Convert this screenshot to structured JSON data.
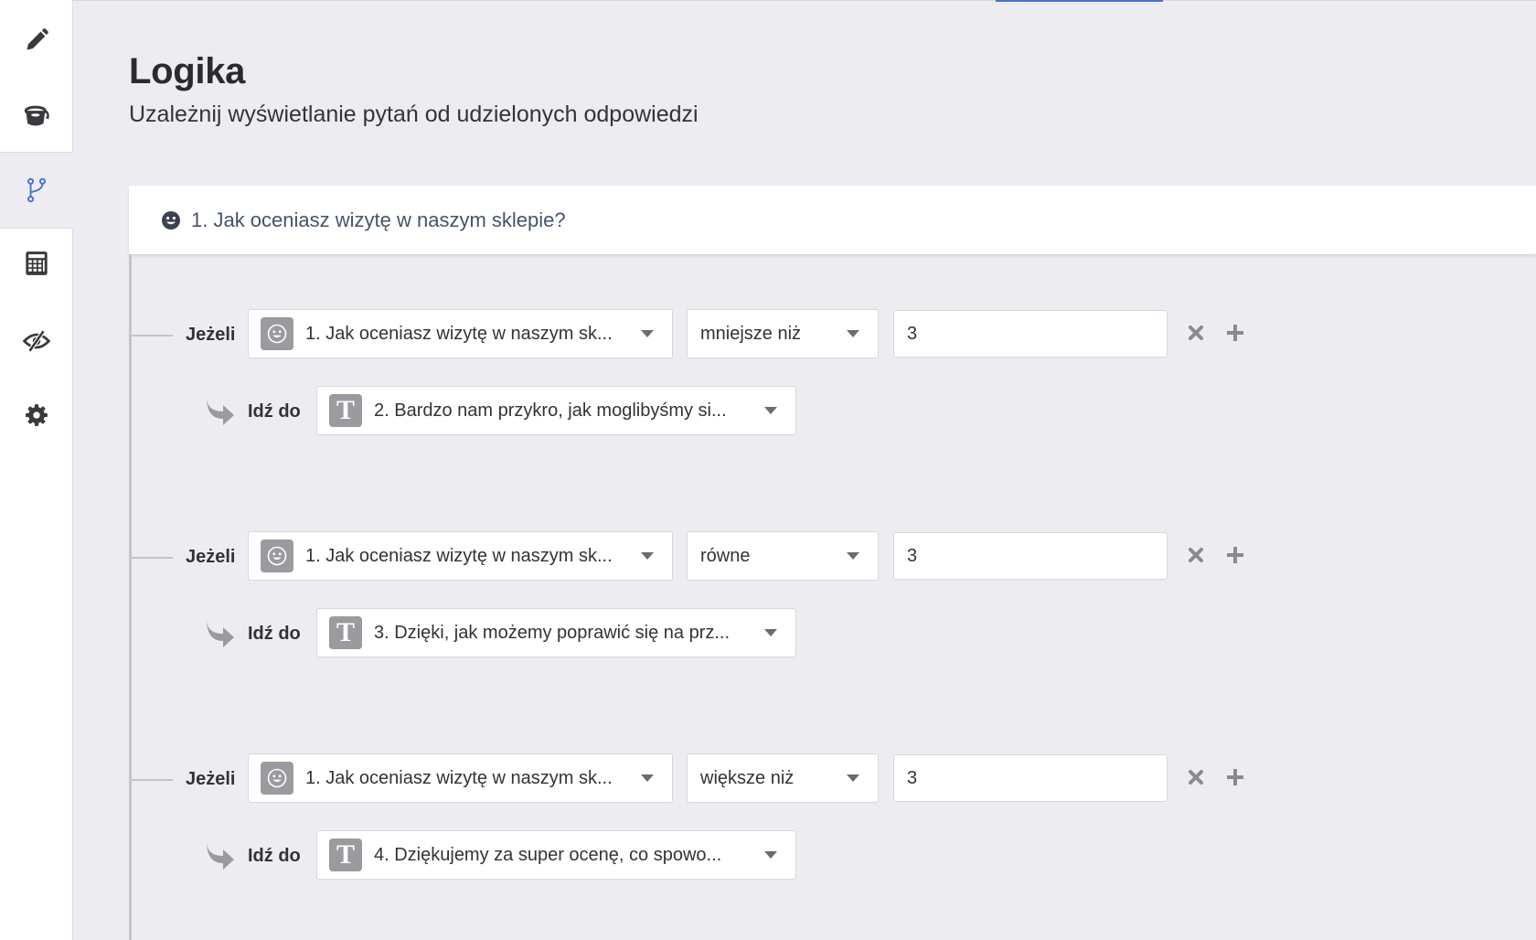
{
  "page": {
    "title": "Logika",
    "subtitle": "Uzależnij wyświetlanie pytań od udzielonych odpowiedzi"
  },
  "sidebar": {
    "items": [
      {
        "id": "edit",
        "icon": "pencil-icon",
        "active": false
      },
      {
        "id": "design",
        "icon": "paint-bucket-icon",
        "active": false
      },
      {
        "id": "logic",
        "icon": "branch-icon",
        "active": true
      },
      {
        "id": "calculator",
        "icon": "calculator-icon",
        "active": false
      },
      {
        "id": "visibility",
        "icon": "eye-slash-icon",
        "active": false
      },
      {
        "id": "settings",
        "icon": "gear-icon",
        "active": false
      }
    ]
  },
  "question": {
    "icon": "smiley-icon",
    "title": "1. Jak oceniasz wizytę w naszym sklepie?"
  },
  "rules": [
    {
      "if_label": "Jeżeli",
      "question": "1. Jak oceniasz wizytę w naszym sk...",
      "operator": "mniejsze niż",
      "value": "3",
      "goto_label": "Idź do",
      "goto_target": "2. Bardzo nam przykro, jak moglibyśmy si..."
    },
    {
      "if_label": "Jeżeli",
      "question": "1. Jak oceniasz wizytę w naszym sk...",
      "operator": "równe",
      "value": "3",
      "goto_label": "Idź do",
      "goto_target": "3. Dzięki, jak możemy poprawić się na prz..."
    },
    {
      "if_label": "Jeżeli",
      "question": "1. Jak oceniasz wizytę w naszym sk...",
      "operator": "większe niż",
      "value": "3",
      "goto_label": "Idź do",
      "goto_target": "4. Dziękujemy za super ocenę, co spowo..."
    }
  ],
  "colors": {
    "accent": "#4c6fd8",
    "background": "#ededf1",
    "icon_gray": "#3a3a3e",
    "badge_gray": "#9b9b9f"
  }
}
